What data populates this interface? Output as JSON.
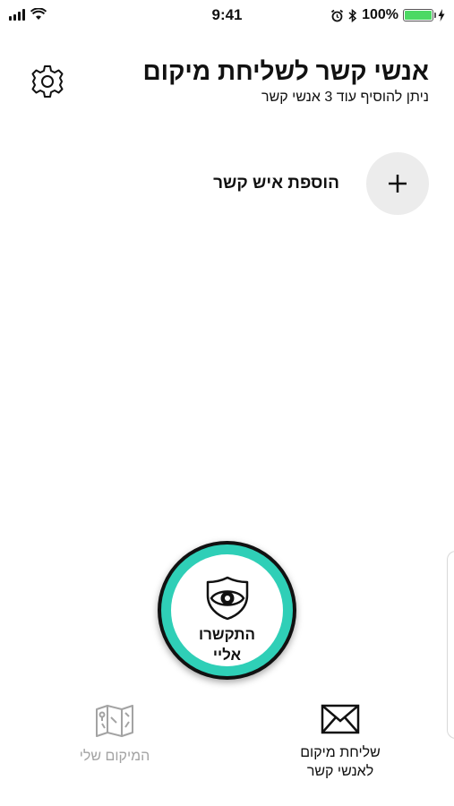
{
  "status_bar": {
    "time": "9:41",
    "battery_percent": "100%",
    "battery_level": 1.0,
    "icons": [
      "signal-icon",
      "wifi-icon",
      "alarm-icon",
      "bluetooth-icon",
      "battery-icon",
      "charging-icon"
    ]
  },
  "header": {
    "title": "אנשי קשר לשליחת מיקום",
    "subtitle": "ניתן להוסיף עוד 3 אנשי קשר",
    "settings_icon": "gear-icon"
  },
  "add_contact": {
    "label": "הוספת איש קשר",
    "icon": "plus-icon"
  },
  "sos_button": {
    "line1": "התקשרו",
    "line2": "אליי",
    "icon": "shield-eye-icon",
    "ring_color": "#2fcfb7"
  },
  "tabs": [
    {
      "line1": "שליחת מיקום",
      "line2": "לאנשי קשר",
      "icon": "envelope-icon",
      "active": true
    },
    {
      "line1": "המיקום שלי",
      "icon": "map-icon",
      "active": false
    }
  ]
}
